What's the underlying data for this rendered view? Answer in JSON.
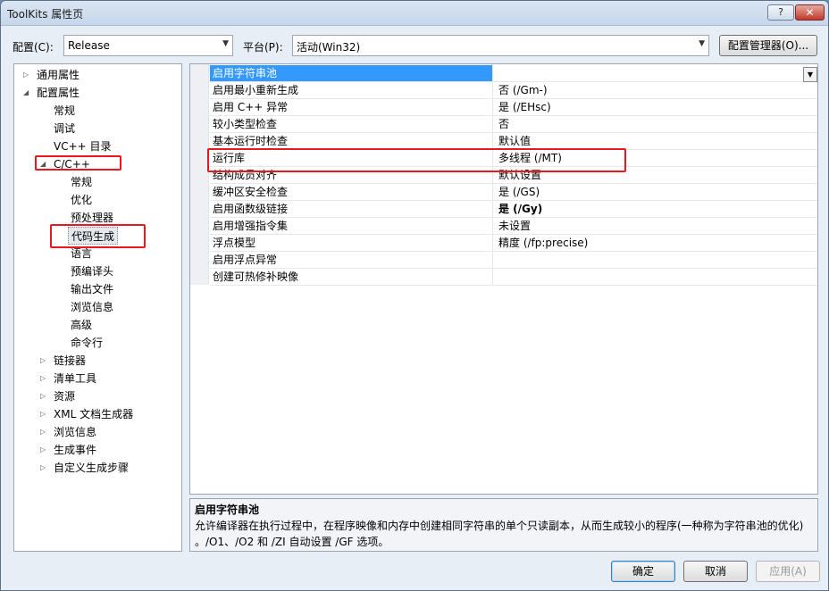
{
  "window": {
    "title": "ToolKits 属性页",
    "help_glyph": "?",
    "close_glyph": "✕"
  },
  "toolbar": {
    "config_label": "配置(C):",
    "config_value": "Release",
    "platform_label": "平台(P):",
    "platform_value": "活动(Win32)",
    "config_manager_label": "配置管理器(O)..."
  },
  "tree": {
    "items": [
      {
        "label": "通用属性",
        "expander": "▷"
      },
      {
        "label": "配置属性",
        "expander": "◢"
      },
      {
        "label": "常规"
      },
      {
        "label": "调试"
      },
      {
        "label": "VC++ 目录"
      },
      {
        "label": "C/C++",
        "expander": "◢"
      },
      {
        "label": "常规"
      },
      {
        "label": "优化"
      },
      {
        "label": "预处理器"
      },
      {
        "label": "代码生成"
      },
      {
        "label": "语言"
      },
      {
        "label": "预编译头"
      },
      {
        "label": "输出文件"
      },
      {
        "label": "浏览信息"
      },
      {
        "label": "高级"
      },
      {
        "label": "命令行"
      },
      {
        "label": "链接器",
        "expander": "▷"
      },
      {
        "label": "清单工具",
        "expander": "▷"
      },
      {
        "label": "资源",
        "expander": "▷"
      },
      {
        "label": "XML 文档生成器",
        "expander": "▷"
      },
      {
        "label": "浏览信息",
        "expander": "▷"
      },
      {
        "label": "生成事件",
        "expander": "▷"
      },
      {
        "label": "自定义生成步骤",
        "expander": "▷"
      }
    ]
  },
  "grid": {
    "rows": [
      {
        "name": "启用字符串池",
        "value": ""
      },
      {
        "name": "启用最小重新生成",
        "value": "否 (/Gm-)"
      },
      {
        "name": "启用 C++ 异常",
        "value": "是 (/EHsc)"
      },
      {
        "name": "较小类型检查",
        "value": "否"
      },
      {
        "name": "基本运行时检查",
        "value": "默认值"
      },
      {
        "name": "运行库",
        "value": "多线程 (/MT)"
      },
      {
        "name": "结构成员对齐",
        "value": "默认设置"
      },
      {
        "name": "缓冲区安全检查",
        "value": "是 (/GS)"
      },
      {
        "name": "启用函数级链接",
        "value": "是 (/Gy)"
      },
      {
        "name": "启用增强指令集",
        "value": "未设置"
      },
      {
        "name": "浮点模型",
        "value": "精度 (/fp:precise)"
      },
      {
        "name": "启用浮点异常",
        "value": ""
      },
      {
        "name": "创建可热修补映像",
        "value": ""
      }
    ],
    "dropdown_glyph": "▼"
  },
  "description": {
    "title": "启用字符串池",
    "line1": "允许编译器在执行过程中，在程序映像和内存中创建相同字符串的单个只读副本，从而生成较小的程序(一种称为字符串池的优化)",
    "line2": "。/O1、/O2 和 /ZI 自动设置 /GF 选项。"
  },
  "buttons": {
    "ok": "确定",
    "cancel": "取消",
    "apply": "应用(A)"
  },
  "colors": {
    "selection": "#3399ff",
    "highlight_box": "#e8181e"
  }
}
